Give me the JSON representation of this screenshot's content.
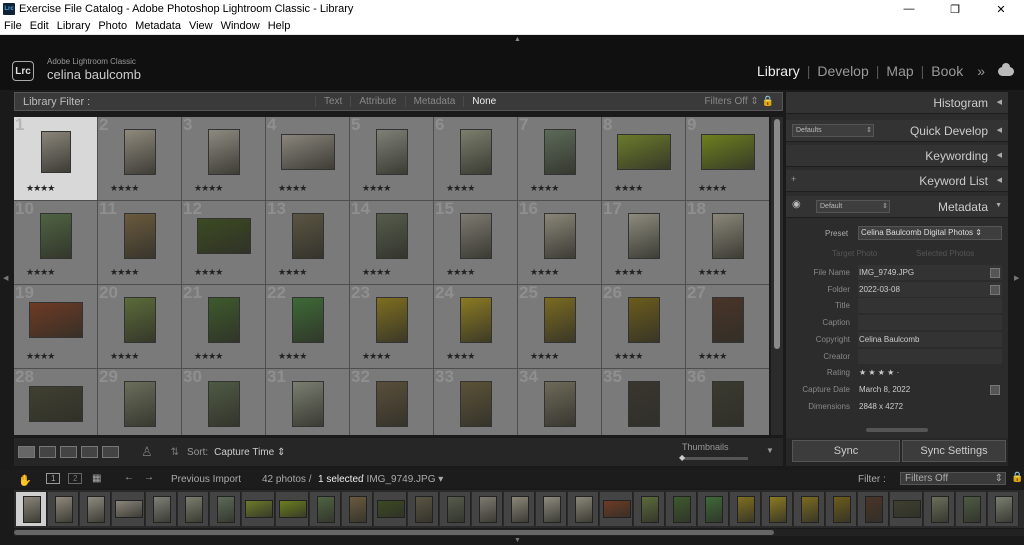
{
  "window": {
    "title": "Exercise File Catalog - Adobe Photoshop Lightroom Classic - Library",
    "app_icon_text": "Lrc",
    "minimize": "—",
    "maximize": "❐",
    "close": "✕"
  },
  "menu": [
    "File",
    "Edit",
    "Library",
    "Photo",
    "Metadata",
    "View",
    "Window",
    "Help"
  ],
  "identity": {
    "logo_text": "Lrc",
    "product": "Adobe Lightroom Classic",
    "user": "celina baulcomb"
  },
  "modules": [
    {
      "label": "Library",
      "active": true
    },
    {
      "label": "Develop",
      "active": false
    },
    {
      "label": "Map",
      "active": false
    },
    {
      "label": "Book",
      "active": false
    }
  ],
  "modules_more": "»",
  "filterbar": {
    "label": "Library Filter :",
    "options": [
      {
        "label": "Text",
        "on": false
      },
      {
        "label": "Attribute",
        "on": false
      },
      {
        "label": "Metadata",
        "on": false
      },
      {
        "label": "None",
        "on": true
      }
    ],
    "status": "Filters Off",
    "lock_icon": "lock-icon"
  },
  "grid": {
    "rating_text": "★★★★",
    "cells": [
      {
        "n": "1",
        "w": 30,
        "h": 42,
        "c": "#8a857a",
        "sel": true
      },
      {
        "n": "2",
        "w": 32,
        "h": 46,
        "c": "#8f897d"
      },
      {
        "n": "3",
        "w": 32,
        "h": 46,
        "c": "#8d8a80"
      },
      {
        "n": "4",
        "w": 54,
        "h": 36,
        "c": "#8a857c"
      },
      {
        "n": "5",
        "w": 32,
        "h": 46,
        "c": "#7e8076"
      },
      {
        "n": "6",
        "w": 32,
        "h": 46,
        "c": "#7b7f6c"
      },
      {
        "n": "7",
        "w": 32,
        "h": 46,
        "c": "#5c6a58"
      },
      {
        "n": "8",
        "w": 54,
        "h": 36,
        "c": "#6b7a2a"
      },
      {
        "n": "9",
        "w": 54,
        "h": 36,
        "c": "#6c7f1e"
      },
      {
        "n": "10",
        "w": 32,
        "h": 46,
        "c": "#4f6342"
      },
      {
        "n": "11",
        "w": 32,
        "h": 46,
        "c": "#6a5a3e"
      },
      {
        "n": "12",
        "w": 54,
        "h": 36,
        "c": "#3c4a22"
      },
      {
        "n": "13",
        "w": 32,
        "h": 46,
        "c": "#5a5442"
      },
      {
        "n": "14",
        "w": 32,
        "h": 46,
        "c": "#555c4c"
      },
      {
        "n": "15",
        "w": 32,
        "h": 46,
        "c": "#7d7a70"
      },
      {
        "n": "16",
        "w": 32,
        "h": 46,
        "c": "#8a8678"
      },
      {
        "n": "17",
        "w": 32,
        "h": 46,
        "c": "#8d8b7e"
      },
      {
        "n": "18",
        "w": 32,
        "h": 46,
        "c": "#8a8779"
      },
      {
        "n": "19",
        "w": 54,
        "h": 36,
        "c": "#6e3a24"
      },
      {
        "n": "20",
        "w": 32,
        "h": 46,
        "c": "#5b6b3a"
      },
      {
        "n": "21",
        "w": 32,
        "h": 46,
        "c": "#3e5a2c"
      },
      {
        "n": "22",
        "w": 32,
        "h": 46,
        "c": "#3d6a36"
      },
      {
        "n": "23",
        "w": 32,
        "h": 46,
        "c": "#7e6e20"
      },
      {
        "n": "24",
        "w": 32,
        "h": 46,
        "c": "#8a7a22"
      },
      {
        "n": "25",
        "w": 32,
        "h": 46,
        "c": "#7a6a20"
      },
      {
        "n": "26",
        "w": 32,
        "h": 46,
        "c": "#6b5c1c"
      },
      {
        "n": "27",
        "w": 32,
        "h": 46,
        "c": "#4a3428"
      },
      {
        "n": "28",
        "w": 54,
        "h": 36,
        "c": "#3f4030"
      },
      {
        "n": "29",
        "w": 32,
        "h": 46,
        "c": "#6a6e5a"
      },
      {
        "n": "30",
        "w": 32,
        "h": 46,
        "c": "#4e5a44"
      },
      {
        "n": "31",
        "w": 32,
        "h": 46,
        "c": "#7a7e70"
      },
      {
        "n": "32",
        "w": 32,
        "h": 46,
        "c": "#5a4e3a"
      },
      {
        "n": "33",
        "w": 32,
        "h": 46,
        "c": "#5c5238"
      },
      {
        "n": "34",
        "w": 32,
        "h": 46,
        "c": "#6e6a5a"
      },
      {
        "n": "35",
        "w": 32,
        "h": 46,
        "c": "#3a3630"
      },
      {
        "n": "36",
        "w": 32,
        "h": 46,
        "c": "#3a3a30"
      }
    ]
  },
  "toolbar": {
    "sort_label": "Sort:",
    "sort_value": "Capture Time",
    "thumbnails_label": "Thumbnails"
  },
  "right_panel": {
    "histogram": "Histogram",
    "quick_develop": "Quick Develop",
    "quick_develop_preset": "Defaults",
    "keywording": "Keywording",
    "keyword_list": "Keyword List",
    "keyword_list_plus": "+",
    "metadata": "Metadata",
    "metadata_preset": "Default",
    "preset_label": "Preset",
    "preset_value": "Celina Baulcomb Digital Photos",
    "target_photo": "Target Photo",
    "selected_photos": "Selected Photos",
    "fields": [
      {
        "k": "File Name",
        "v": "IMG_9749.JPG",
        "btn": true
      },
      {
        "k": "Folder",
        "v": "2022-03-08",
        "btn": true
      },
      {
        "k": "Title",
        "v": ""
      },
      {
        "k": "Caption",
        "v": ""
      },
      {
        "k": "Copyright",
        "v": "Celina Baulcomb"
      },
      {
        "k": "Creator",
        "v": ""
      },
      {
        "k": "Rating",
        "v": "★ ★ ★ ★  ·",
        "plain": true
      },
      {
        "k": "Capture Date",
        "v": "March 8, 2022",
        "plain": true,
        "btn": true
      },
      {
        "k": "Dimensions",
        "v": "2848 x 4272",
        "plain": true
      }
    ],
    "sync": "Sync",
    "sync_settings": "Sync Settings"
  },
  "filmstrip_bar": {
    "page1": "1",
    "page2": "2",
    "source": "Previous Import",
    "count": "42 photos /",
    "selected": "1 selected",
    "file": "/ IMG_9749.JPG",
    "filter_label": "Filter :",
    "filter_value": "Filters Off"
  },
  "filmstrip": [
    {
      "c": "#8a857a",
      "sel": true
    },
    {
      "c": "#8f897d"
    },
    {
      "c": "#8d8a80"
    },
    {
      "c": "#8a857c",
      "wide": true
    },
    {
      "c": "#7e8076"
    },
    {
      "c": "#7b7f6c"
    },
    {
      "c": "#5c6a58"
    },
    {
      "c": "#6b7a2a",
      "wide": true
    },
    {
      "c": "#6c7f1e",
      "wide": true
    },
    {
      "c": "#4f6342"
    },
    {
      "c": "#6a5a3e"
    },
    {
      "c": "#3c4a22",
      "wide": true
    },
    {
      "c": "#5a5442"
    },
    {
      "c": "#555c4c"
    },
    {
      "c": "#7d7a70"
    },
    {
      "c": "#8a8678"
    },
    {
      "c": "#8d8b7e"
    },
    {
      "c": "#8a8779"
    },
    {
      "c": "#6e3a24",
      "wide": true
    },
    {
      "c": "#5b6b3a"
    },
    {
      "c": "#3e5a2c"
    },
    {
      "c": "#3d6a36"
    },
    {
      "c": "#7e6e20"
    },
    {
      "c": "#8a7a22"
    },
    {
      "c": "#7a6a20"
    },
    {
      "c": "#6b5c1c"
    },
    {
      "c": "#4a3428"
    },
    {
      "c": "#3f4030",
      "wide": true
    },
    {
      "c": "#6a6e5a"
    },
    {
      "c": "#4e5a44"
    },
    {
      "c": "#7a7e70"
    }
  ]
}
